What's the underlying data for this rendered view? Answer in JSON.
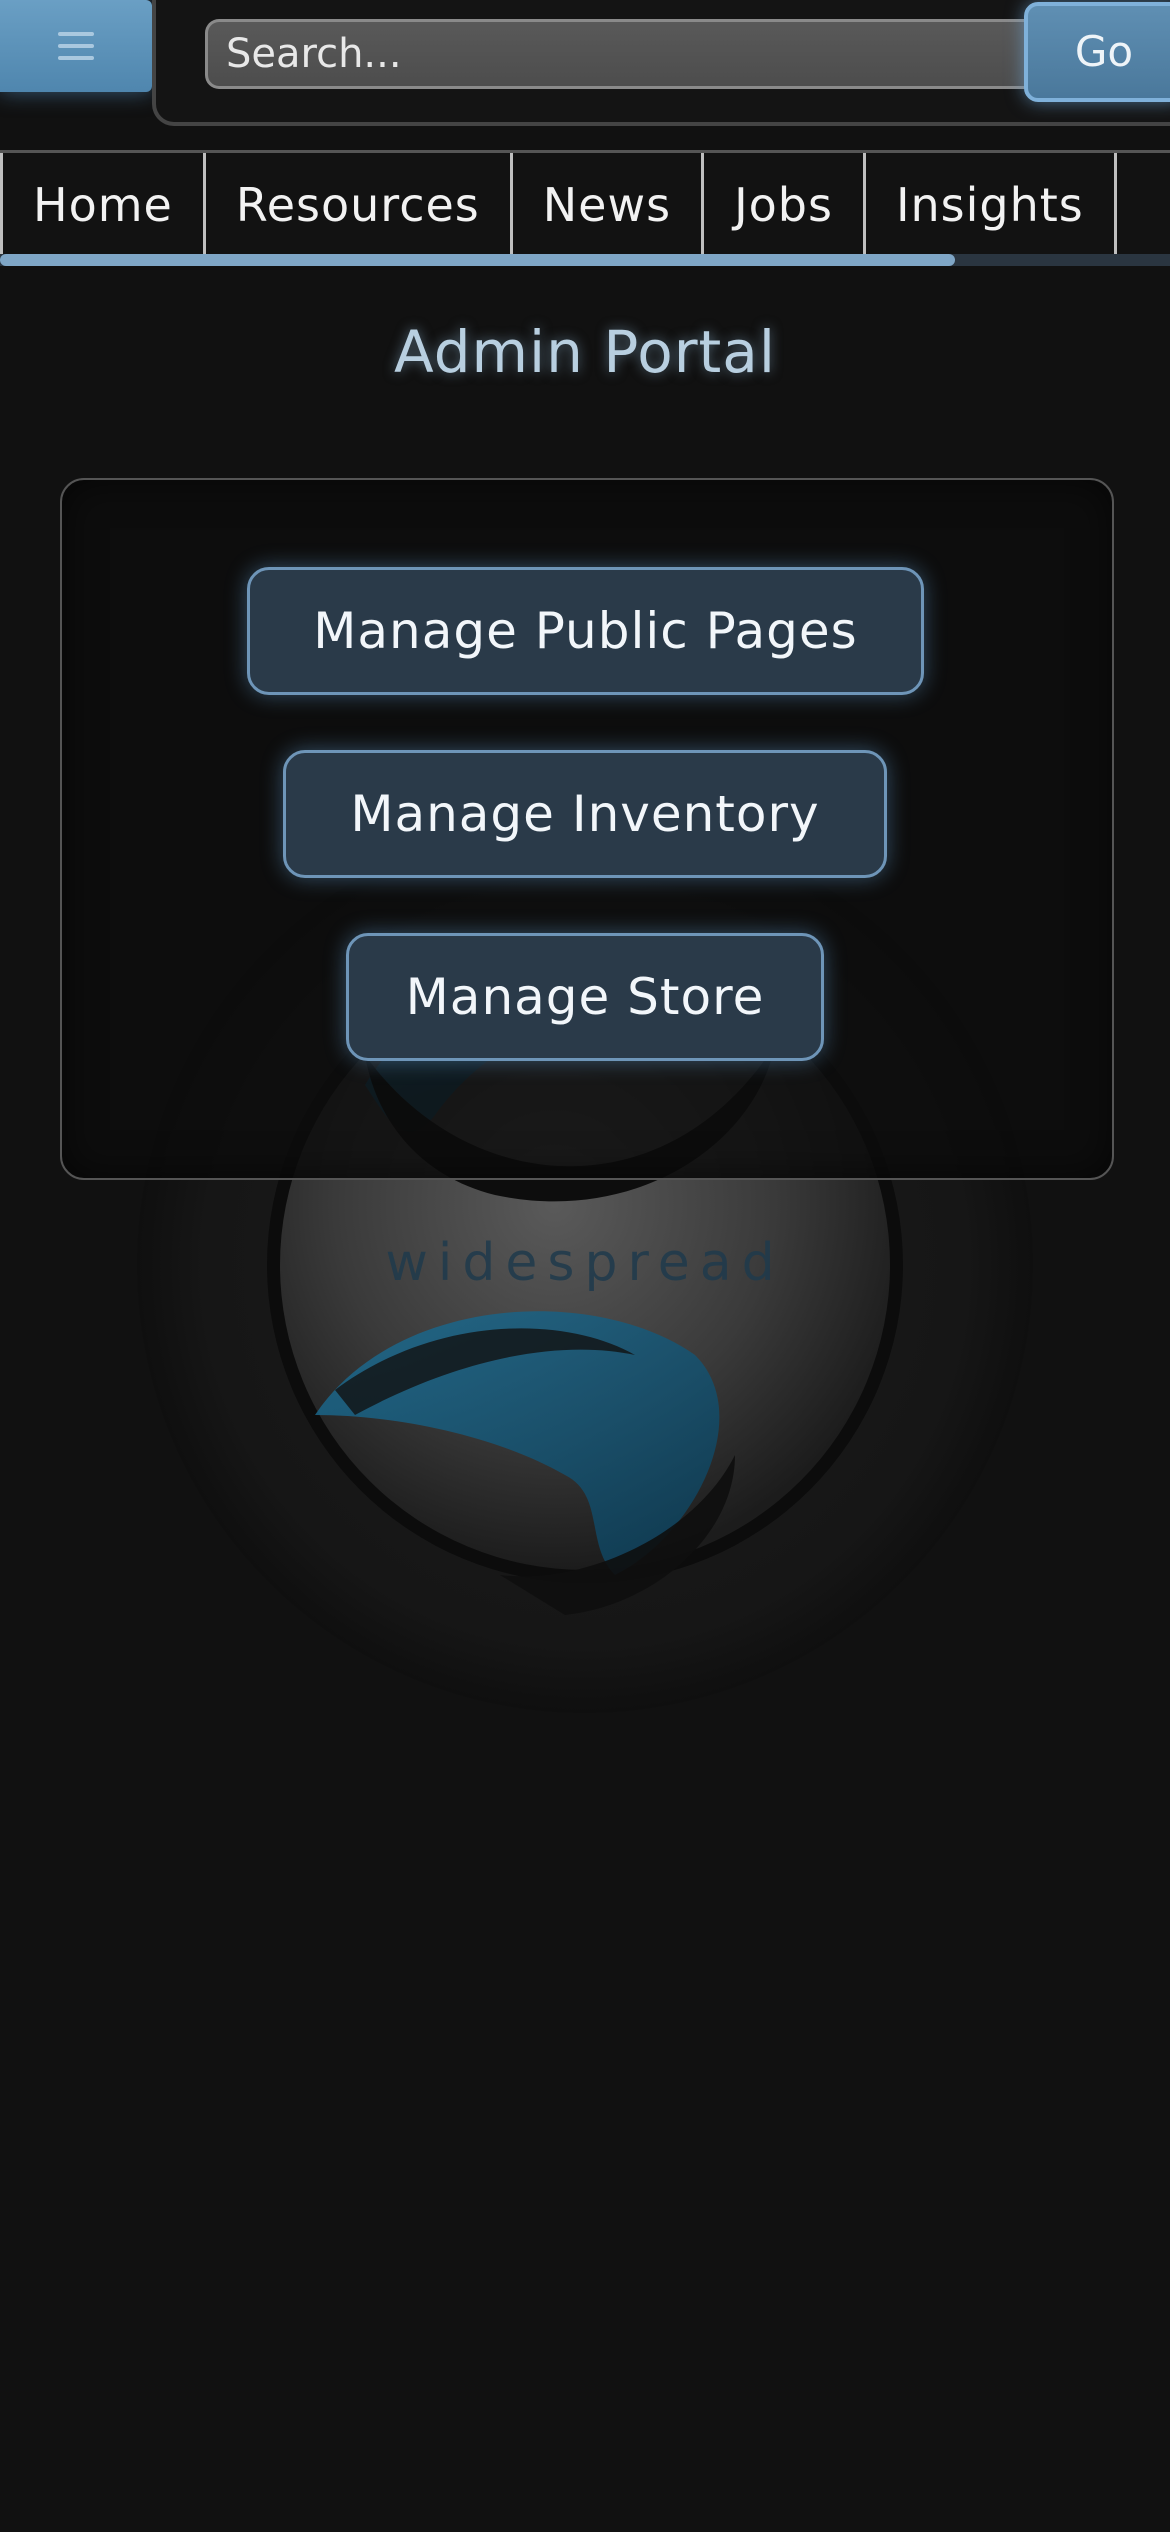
{
  "header": {
    "menu_icon": "hamburger-icon",
    "search_placeholder": "Search...",
    "go_label": "Go"
  },
  "nav": {
    "items": [
      {
        "label": "Home"
      },
      {
        "label": "Resources"
      },
      {
        "label": "News"
      },
      {
        "label": "Jobs"
      },
      {
        "label": "Insights"
      }
    ]
  },
  "main": {
    "title": "Admin Portal",
    "buttons": [
      {
        "label": "Manage Public Pages"
      },
      {
        "label": "Manage Inventory"
      },
      {
        "label": "Manage Store"
      }
    ],
    "background_logo_text": "widespread"
  },
  "colors": {
    "background": "#111111",
    "accent": "#6e95b8",
    "button_fill": "#2a3a49",
    "title": "#b8cfe0"
  }
}
